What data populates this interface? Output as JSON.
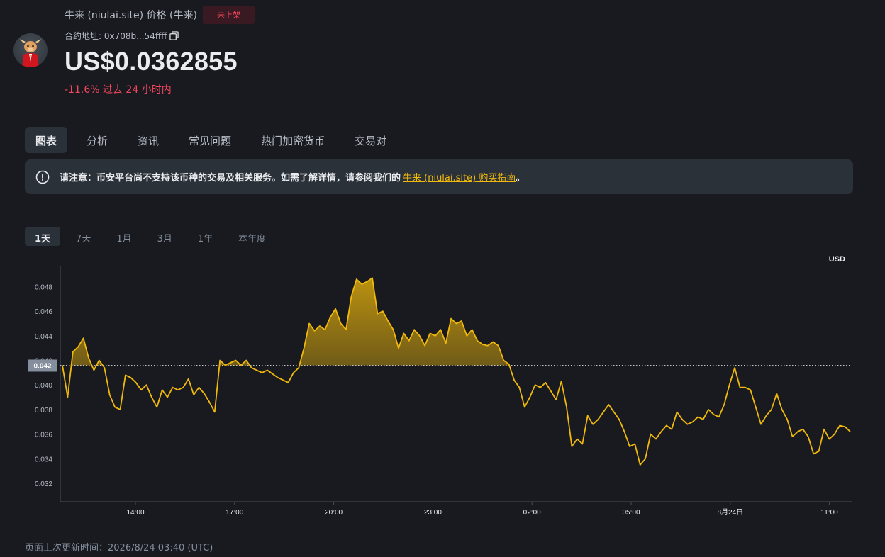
{
  "header": {
    "title": "牛来 (niulai.site) 价格 (牛来)",
    "badge": "未上架",
    "contract_label": "合约地址: 0x708b...54ffff",
    "price": "US$0.0362855",
    "change": "-11.6% 过去 24 小时内"
  },
  "tabs": [
    {
      "label": "图表",
      "active": true
    },
    {
      "label": "分析"
    },
    {
      "label": "资讯"
    },
    {
      "label": "常见问题"
    },
    {
      "label": "热门加密货币"
    },
    {
      "label": "交易对"
    }
  ],
  "notice": {
    "text": "请注意：币安平台尚不支持该币种的交易及相关服务。如需了解详情，请参阅我们的",
    "link": "牛来 (niulai.site) 购买指南",
    "end": "。"
  },
  "ranges": [
    {
      "label": "1天",
      "active": true
    },
    {
      "label": "7天"
    },
    {
      "label": "1月"
    },
    {
      "label": "3月"
    },
    {
      "label": "1年"
    },
    {
      "label": "本年度"
    }
  ],
  "footer": "页面上次更新时间：2026/8/24 03:40 (UTC)",
  "colors": {
    "line": "#f0b90b",
    "down": "#f6465d",
    "bg": "#181a20"
  },
  "chart_data": {
    "type": "line",
    "unit_label": "USD",
    "x_ticks": [
      "14:00",
      "17:00",
      "20:00",
      "23:00",
      "02:00",
      "05:00",
      "8月24日",
      "11:00"
    ],
    "y_ticks": [
      "0.032",
      "0.034",
      "0.036",
      "0.038",
      "0.040",
      "0.042",
      "0.044",
      "0.046",
      "0.048"
    ],
    "ylim": [
      0.0305,
      0.0497
    ],
    "baseline": 0.0416,
    "baseline_label": "0.042",
    "values": [
      0.0416,
      0.039,
      0.0427,
      0.0431,
      0.0438,
      0.0422,
      0.0412,
      0.042,
      0.0414,
      0.0392,
      0.0382,
      0.038,
      0.0408,
      0.0406,
      0.0402,
      0.0396,
      0.04,
      0.039,
      0.0382,
      0.0396,
      0.039,
      0.0398,
      0.0396,
      0.0398,
      0.0405,
      0.0392,
      0.0398,
      0.0393,
      0.0386,
      0.0378,
      0.042,
      0.0416,
      0.0418,
      0.042,
      0.0416,
      0.042,
      0.0414,
      0.0412,
      0.041,
      0.0412,
      0.0409,
      0.0406,
      0.0404,
      0.0402,
      0.041,
      0.0414,
      0.043,
      0.045,
      0.0444,
      0.0448,
      0.0445,
      0.0455,
      0.0462,
      0.045,
      0.0445,
      0.0472,
      0.0486,
      0.0482,
      0.0484,
      0.0487,
      0.0458,
      0.046,
      0.0452,
      0.0445,
      0.043,
      0.0442,
      0.0436,
      0.0445,
      0.044,
      0.0432,
      0.0442,
      0.044,
      0.0445,
      0.0434,
      0.0454,
      0.045,
      0.0452,
      0.044,
      0.0445,
      0.0436,
      0.0433,
      0.0432,
      0.0435,
      0.0432,
      0.042,
      0.0417,
      0.0404,
      0.0398,
      0.0382,
      0.039,
      0.04,
      0.0398,
      0.0402,
      0.0395,
      0.0388,
      0.0403,
      0.0382,
      0.035,
      0.0356,
      0.0352,
      0.0375,
      0.0368,
      0.0372,
      0.0378,
      0.0384,
      0.0378,
      0.0372,
      0.0362,
      0.035,
      0.0352,
      0.0335,
      0.034,
      0.036,
      0.0356,
      0.0362,
      0.0367,
      0.0364,
      0.0378,
      0.0372,
      0.0368,
      0.037,
      0.0374,
      0.0372,
      0.038,
      0.0376,
      0.0374,
      0.0384,
      0.04,
      0.0414,
      0.0398,
      0.0398,
      0.0396,
      0.0382,
      0.0368,
      0.0375,
      0.038,
      0.0393,
      0.038,
      0.0372,
      0.0358,
      0.0362,
      0.0364,
      0.0358,
      0.0344,
      0.0346,
      0.0364,
      0.0356,
      0.036,
      0.0367,
      0.0366,
      0.0362
    ]
  }
}
